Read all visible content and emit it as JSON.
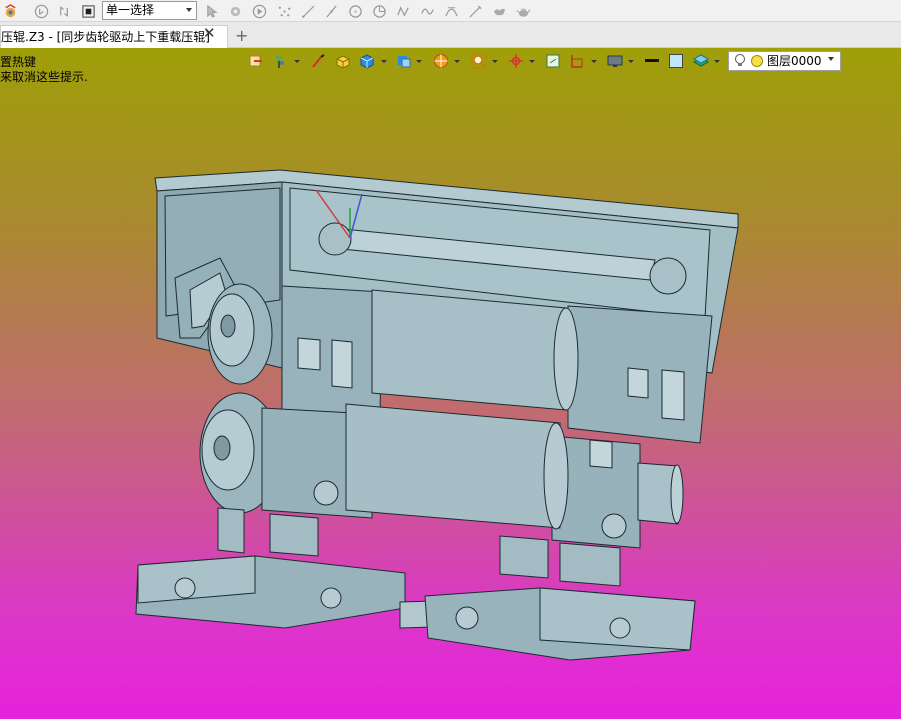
{
  "toolbar": {
    "selection_mode": "单一选择",
    "icons": [
      "app-logo-icon",
      "undo-icon",
      "redo-icon",
      "stop-icon",
      "pointer-icon",
      "filter-icon",
      "play-icon",
      "point-icon",
      "line-icon",
      "slash-icon",
      "circle-icon",
      "curve-icon",
      "spline-icon",
      "arc-icon",
      "pen-icon",
      "bird-icon",
      "teapot-icon"
    ]
  },
  "tabs": [
    {
      "label": "压辊.Z3 - [同步齿轮驱动上下重载压辊]",
      "close": "✕"
    }
  ],
  "tab_add": "+",
  "viewport": {
    "hints": [
      "置热键",
      "来取消这些提示."
    ],
    "background_top": "#9f9f08",
    "background_bottom": "#e522dc",
    "view_toolbar_icons": [
      "sketch-icon",
      "wand-icon",
      "brush-icon",
      "box-icon",
      "cube-icon",
      "render-icon",
      "section-icon",
      "zoom-icon",
      "orient-icon",
      "frame-icon",
      "display-icon",
      "line-weight-icon",
      "color-swatch-icon",
      "layer-stack-icon"
    ],
    "layer": {
      "name": "图层0000"
    }
  },
  "model": {
    "color": "#9fbac3",
    "edge_color": "#1c2a30"
  }
}
